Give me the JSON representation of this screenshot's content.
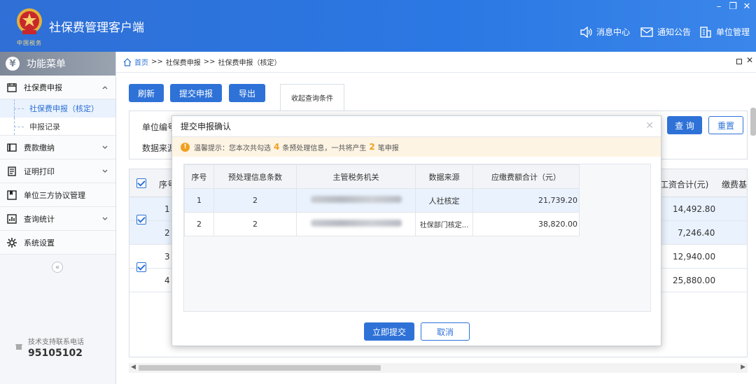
{
  "header": {
    "app_title": "社保费管理客户端",
    "logo_caption": "中国税务",
    "links": [
      {
        "label": "消息中心",
        "icon": "speaker-icon"
      },
      {
        "label": "通知公告",
        "icon": "mail-icon"
      },
      {
        "label": "单位管理",
        "icon": "building-icon"
      }
    ],
    "window_controls": [
      "minimize-icon",
      "restore-icon",
      "close-icon"
    ]
  },
  "sidebar": {
    "menu_title": "功能菜单",
    "items": [
      {
        "label": "社保费申报",
        "icon": "calendar-icon",
        "expanded": true,
        "children": [
          {
            "label": "社保费申报（核定）",
            "active": true
          },
          {
            "label": "申报记录",
            "active": false
          }
        ]
      },
      {
        "label": "费款缴纳",
        "icon": "wallet-icon"
      },
      {
        "label": "证明打印",
        "icon": "document-icon"
      },
      {
        "label": "单位三方协议管理",
        "icon": "agreement-icon"
      },
      {
        "label": "查询统计",
        "icon": "chart-icon"
      },
      {
        "label": "系统设置",
        "icon": "gear-icon"
      }
    ],
    "support_label": "技术支持联系电话",
    "support_phone": "95105102"
  },
  "breadcrumb": {
    "home": "首页",
    "sep": ">>",
    "level1": "社保费申报",
    "level2": "社保费申报（核定）"
  },
  "toolbar": {
    "refresh": "刷新",
    "submit": "提交申报",
    "export": "导出",
    "collapse_query": "收起查询条件",
    "query": "查 询",
    "reset": "重置"
  },
  "query": {
    "unit_code_label": "单位编号",
    "data_source_label": "数据来源"
  },
  "grid": {
    "columns": {
      "seq": "序号",
      "wage_total": "工资合计(元)",
      "fee": "缴费基"
    },
    "rows": [
      {
        "seq": "1",
        "wage": "14,492.80",
        "checked": true,
        "selected": true
      },
      {
        "seq": "2",
        "wage": "7,246.40",
        "checked": true,
        "selected": true
      },
      {
        "seq": "3",
        "wage": "12,940.00",
        "checked": true,
        "selected": false
      },
      {
        "seq": "4",
        "wage": "25,880.00",
        "checked": true,
        "selected": false
      }
    ]
  },
  "modal": {
    "title": "提交申报确认",
    "tip_prefix": "温馨提示：您本次共勾选",
    "tip_count": "4",
    "tip_middle": "条预处理信息，一共将产生",
    "tip_result": "2",
    "tip_suffix": "笔申报",
    "columns": [
      "序号",
      "预处理信息条数",
      "主管税务机关",
      "数据来源",
      "应缴费额合计（元）"
    ],
    "rows": [
      {
        "seq": "1",
        "count": "2",
        "source": "人社核定",
        "amount": "21,739.20"
      },
      {
        "seq": "2",
        "count": "2",
        "source": "社保部门核定...",
        "amount": "38,820.00"
      }
    ],
    "confirm_label": "立即提交",
    "cancel_label": "取消"
  },
  "colors": {
    "primary": "#2e72d8",
    "header_bg": "#2b78e4",
    "warning": "#f0a020"
  }
}
